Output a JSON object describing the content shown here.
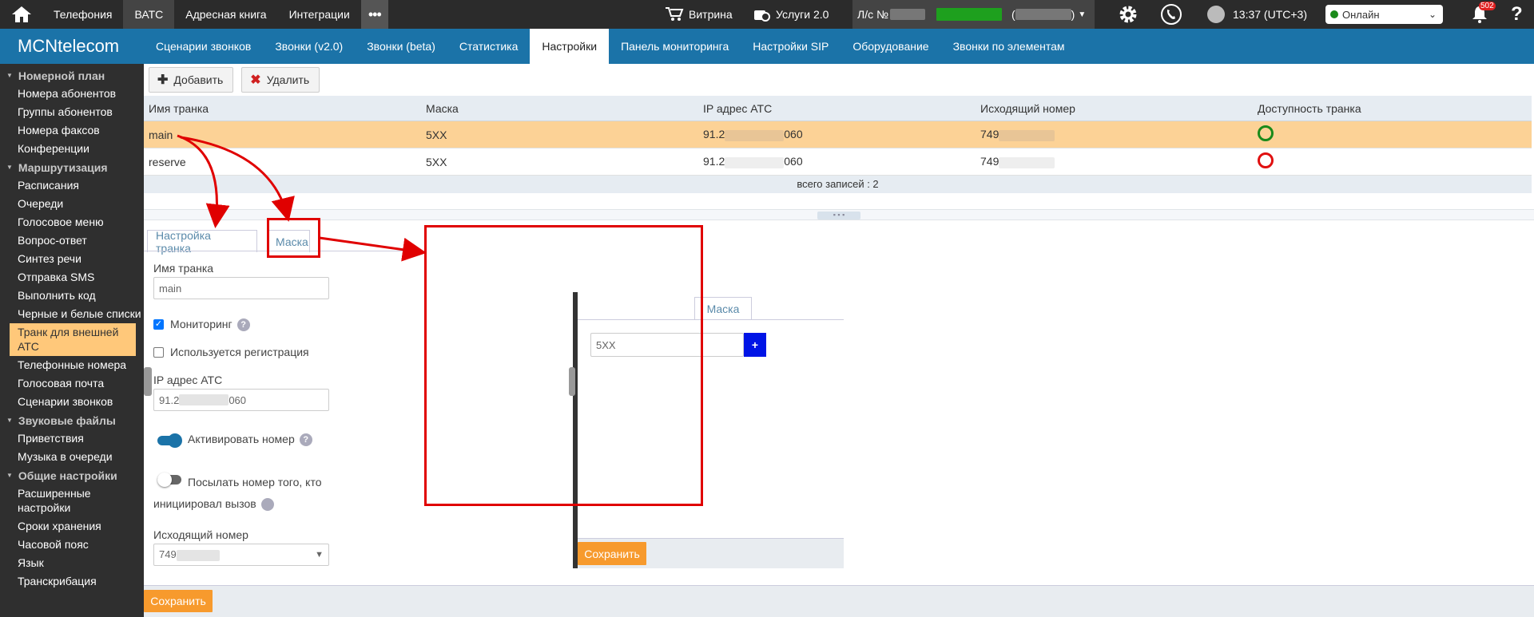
{
  "topbar": {
    "tabs": [
      "Телефония",
      "ВАТС",
      "Адресная книга",
      "Интеграции"
    ],
    "more": "•••",
    "showcase": "Витрина",
    "services": "Услуги 2.0",
    "account_prefix": "Л/с №",
    "time": "13:37 (UTC+3)",
    "status": "Онлайн",
    "notifications": "502",
    "help": "?"
  },
  "navbar": {
    "logo": "MCNtelecom",
    "tabs": [
      "Сценарии звонков",
      "Звонки (v2.0)",
      "Звонки (beta)",
      "Статистика",
      "Настройки",
      "Панель мониторинга",
      "Настройки SIP",
      "Оборудование",
      "Звонки по элементам"
    ]
  },
  "sidebar": {
    "s1": "Номерной план",
    "i1": "Номера абонентов",
    "i2": "Группы абонентов",
    "i3": "Номера факсов",
    "i4": "Конференции",
    "s2": "Маршрутизация",
    "i5": "Расписания",
    "i6": "Очереди",
    "i7": "Голосовое меню",
    "i8": "Вопрос-ответ",
    "i9": "Синтез речи",
    "i10": "Отправка SMS",
    "i11": "Выполнить код",
    "i12": "Черные и белые списки",
    "i13": "Транк для внешней АТС",
    "i14": "Телефонные номера",
    "i15": "Голосовая почта",
    "i16": "Сценарии звонков",
    "s3": "Звуковые файлы",
    "i17": "Приветствия",
    "i18": "Музыка в очереди",
    "s4": "Общие настройки",
    "i19": "Расширенные настройки",
    "i20": "Сроки хранения",
    "i21": "Часовой пояс",
    "i22": "Язык",
    "i23": "Транскрибация"
  },
  "toolbar": {
    "add": "Добавить",
    "delete": "Удалить"
  },
  "grid": {
    "headers": [
      "Имя транка",
      "Маска",
      "IP адрес АТС",
      "Исходящий номер",
      "Доступность транка"
    ],
    "rows": [
      {
        "name": "main",
        "mask": "5XX",
        "ip_a": "91.2",
        "ip_b": "060",
        "out": "749",
        "availability": "available"
      },
      {
        "name": "reserve",
        "mask": "5XX",
        "ip_a": "91.2",
        "ip_b": "060",
        "out": "749",
        "availability": "unavailable"
      }
    ],
    "footer": "всего записей : 2"
  },
  "form": {
    "tab_settings": "Настройка транка",
    "tab_mask": "Маска",
    "name_label": "Имя транка",
    "name_value": "main",
    "monitoring": "Мониторинг",
    "registration": "Используется регистрация",
    "ip_label": "IP адрес АТС",
    "ip_a": "91.2",
    "ip_b": "060",
    "activate": "Активировать номер",
    "send_number": "Посылать номер того, кто инициировал вызов",
    "out_label": "Исходящий номер",
    "out_value": "749",
    "save": "Сохранить"
  },
  "dialog": {
    "tab": "Маска",
    "mask_value": "5XX",
    "add": "+",
    "save": "Сохранить"
  },
  "colors": {
    "accent": "#1b73a8",
    "selected_row": "#fcd296",
    "save": "#f79a2d",
    "ok": "#1a8a1a",
    "fail": "#e01010",
    "annotation": "#e00000"
  }
}
